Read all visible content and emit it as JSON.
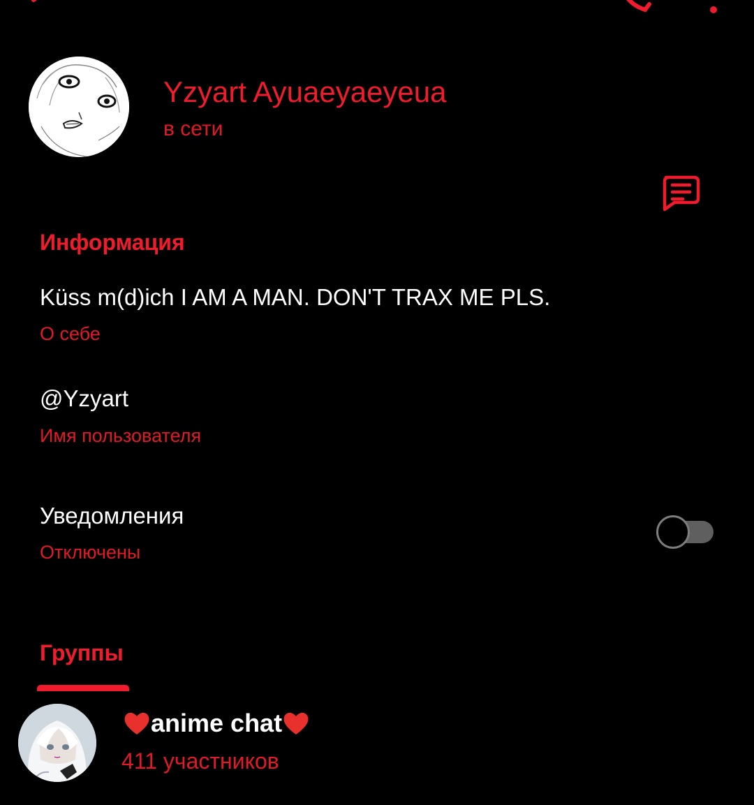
{
  "colors": {
    "accent": "#f01c2d",
    "background": "#000000",
    "text": "#ffffff",
    "toggle_off": "#5f5f5f"
  },
  "top_bar": {
    "icons": [
      "arrow-back-icon",
      "phone-icon",
      "more-vertical-icon"
    ]
  },
  "profile": {
    "name": "Yzyart Ayuaeyaeyeua",
    "status": "в сети",
    "avatar_icon": "anime-face-avatar",
    "message_icon": "message-icon"
  },
  "info": {
    "section_title": "Информация",
    "bio": "Küss m(d)ich I AM A MAN. DON'T TRAX ME PLS.",
    "bio_caption": "О себе",
    "username": "@Yzyart",
    "username_caption": "Имя пользователя",
    "notifications_label": "Уведомления",
    "notifications_value": "Отключены",
    "notifications_enabled": false
  },
  "groups": {
    "section_title": "Группы",
    "items": [
      {
        "name": "anime chat",
        "members": "411 участников",
        "decoration_icon": "heart-icon"
      }
    ]
  }
}
